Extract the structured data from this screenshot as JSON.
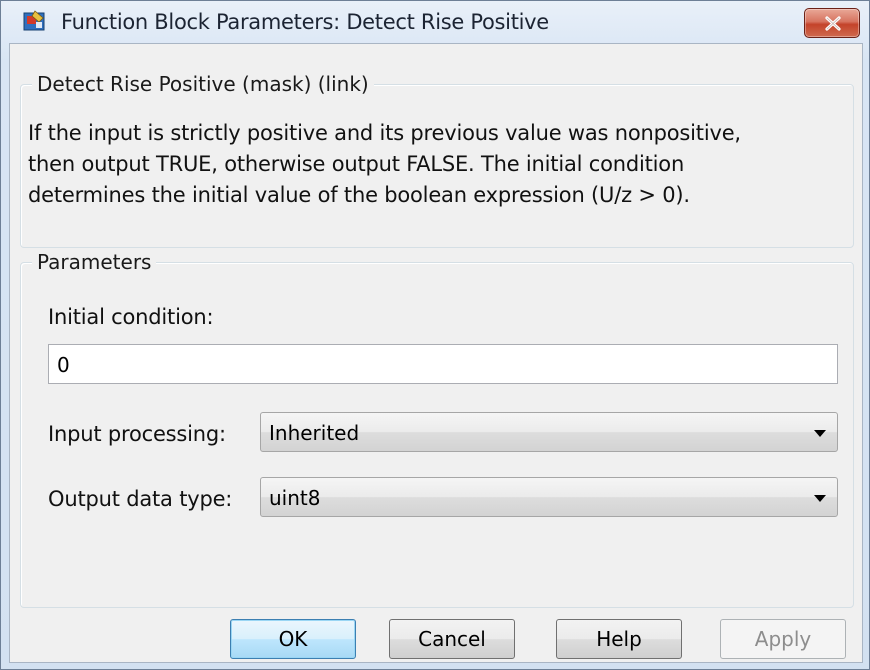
{
  "window": {
    "title": "Function Block Parameters: Detect Rise Positive"
  },
  "description": {
    "group_title": "Detect Rise Positive (mask) (link)",
    "lines": [
      "If the input is strictly positive and its previous value was nonpositive,",
      "then output TRUE, otherwise output FALSE.  The initial condition",
      "determines the initial value of the boolean expression (U/z > 0)."
    ]
  },
  "parameters": {
    "group_title": "Parameters",
    "initial_condition": {
      "label": "Initial condition:",
      "value": "0"
    },
    "input_processing": {
      "label": "Input processing:",
      "value": "Inherited"
    },
    "output_data_type": {
      "label": "Output data type:",
      "value": "uint8"
    }
  },
  "buttons": {
    "ok": "OK",
    "cancel": "Cancel",
    "help": "Help",
    "apply": "Apply"
  },
  "icons": {
    "app": "simulink-block-icon",
    "close": "close-icon",
    "dropdown": "chevron-down-icon"
  }
}
